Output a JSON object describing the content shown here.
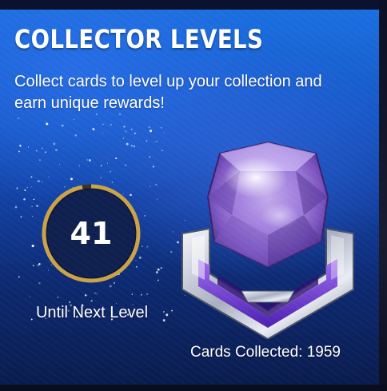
{
  "header": {
    "title": "COLLECTOR LEVELS",
    "subtitle": "Collect cards to level up your collection and earn unique rewards!"
  },
  "level_progress": {
    "cards_until_next_level": "41",
    "caption": "Until Next Level",
    "ring_fill_fraction": 0.97
  },
  "collection": {
    "label": "Cards Collected:",
    "count": "1959"
  },
  "colors": {
    "ring_gold": "#c9a24a",
    "ring_inner": "#0f1f4e",
    "panel_blue": "#1656c6",
    "gem_purple": "#8b63c9",
    "badge_violet": "#6a2fd0"
  },
  "icons": {
    "badge": "purple-gem-badge-icon"
  }
}
